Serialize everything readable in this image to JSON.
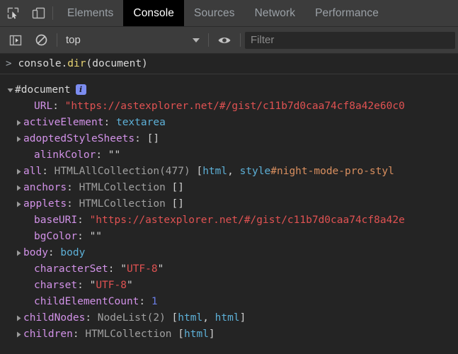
{
  "tabbar": {
    "icons": [
      {
        "name": "inspect-element-icon",
        "title": "Inspect element"
      },
      {
        "name": "device-toolbar-icon",
        "title": "Toggle device toolbar"
      }
    ],
    "tabs": [
      {
        "label": "Elements",
        "active": false
      },
      {
        "label": "Console",
        "active": true
      },
      {
        "label": "Sources",
        "active": false
      },
      {
        "label": "Network",
        "active": false
      },
      {
        "label": "Performance",
        "active": false
      }
    ]
  },
  "console_toolbar": {
    "sidebar_toggle_label": "console-sidebar-icon",
    "clear_label": "clear-console-icon",
    "context": "top",
    "eye_label": "live-expression-icon",
    "filter_value": "",
    "filter_placeholder": "Filter"
  },
  "prompt": {
    "arrow": ">",
    "cmd_a": "console.",
    "cmd_b": "dir",
    "cmd_c": "(document)"
  },
  "output": {
    "root": {
      "name": "#document",
      "info_badge": "i",
      "expanded": true
    },
    "properties": [
      {
        "key": "URL",
        "expandable": false,
        "value_parts": [
          {
            "text": ": ",
            "cls": "punct"
          },
          {
            "text": "\"https://astexplorer.net/#/gist/c11b7d0caa74cf8a42e60c0",
            "cls": "v-string"
          }
        ]
      },
      {
        "key": "activeElement",
        "expandable": true,
        "value_parts": [
          {
            "text": ": ",
            "cls": "punct"
          },
          {
            "text": "textarea",
            "cls": "v-node"
          }
        ]
      },
      {
        "key": "adoptedStyleSheets",
        "expandable": true,
        "value_parts": [
          {
            "text": ": ",
            "cls": "punct"
          },
          {
            "text": "[]",
            "cls": "punct"
          }
        ]
      },
      {
        "key": "alinkColor",
        "expandable": false,
        "value_parts": [
          {
            "text": ": ",
            "cls": "punct"
          },
          {
            "text": "\"\"",
            "cls": "punct"
          }
        ]
      },
      {
        "key": "all",
        "expandable": true,
        "value_parts": [
          {
            "text": ": ",
            "cls": "punct"
          },
          {
            "text": "HTMLAllCollection(477) ",
            "cls": "v-gray"
          },
          {
            "text": "[",
            "cls": "punct"
          },
          {
            "text": "html",
            "cls": "v-node"
          },
          {
            "text": ", ",
            "cls": "punct"
          },
          {
            "text": "style",
            "cls": "v-node"
          },
          {
            "text": "#night-mode-pro-styl",
            "cls": "v-orange"
          }
        ]
      },
      {
        "key": "anchors",
        "expandable": true,
        "value_parts": [
          {
            "text": ": ",
            "cls": "punct"
          },
          {
            "text": "HTMLCollection ",
            "cls": "v-gray"
          },
          {
            "text": "[]",
            "cls": "punct"
          }
        ]
      },
      {
        "key": "applets",
        "expandable": true,
        "value_parts": [
          {
            "text": ": ",
            "cls": "punct"
          },
          {
            "text": "HTMLCollection ",
            "cls": "v-gray"
          },
          {
            "text": "[]",
            "cls": "punct"
          }
        ]
      },
      {
        "key": "baseURI",
        "expandable": false,
        "value_parts": [
          {
            "text": ": ",
            "cls": "punct"
          },
          {
            "text": "\"https://astexplorer.net/#/gist/c11b7d0caa74cf8a42e",
            "cls": "v-string"
          }
        ]
      },
      {
        "key": "bgColor",
        "expandable": false,
        "value_parts": [
          {
            "text": ": ",
            "cls": "punct"
          },
          {
            "text": "\"\"",
            "cls": "punct"
          }
        ]
      },
      {
        "key": "body",
        "expandable": true,
        "value_parts": [
          {
            "text": ": ",
            "cls": "punct"
          },
          {
            "text": "body",
            "cls": "v-node"
          }
        ]
      },
      {
        "key": "characterSet",
        "expandable": false,
        "value_parts": [
          {
            "text": ": ",
            "cls": "punct"
          },
          {
            "text": "\"",
            "cls": "punct"
          },
          {
            "text": "UTF-8",
            "cls": "v-string"
          },
          {
            "text": "\"",
            "cls": "punct"
          }
        ]
      },
      {
        "key": "charset",
        "expandable": false,
        "value_parts": [
          {
            "text": ": ",
            "cls": "punct"
          },
          {
            "text": "\"",
            "cls": "punct"
          },
          {
            "text": "UTF-8",
            "cls": "v-string"
          },
          {
            "text": "\"",
            "cls": "punct"
          }
        ]
      },
      {
        "key": "childElementCount",
        "expandable": false,
        "value_parts": [
          {
            "text": ": ",
            "cls": "punct"
          },
          {
            "text": "1",
            "cls": "v-num"
          }
        ]
      },
      {
        "key": "childNodes",
        "expandable": true,
        "value_parts": [
          {
            "text": ": ",
            "cls": "punct"
          },
          {
            "text": "NodeList(2) ",
            "cls": "v-gray"
          },
          {
            "text": "[",
            "cls": "punct"
          },
          {
            "text": "html",
            "cls": "v-node"
          },
          {
            "text": ", ",
            "cls": "punct"
          },
          {
            "text": "html",
            "cls": "v-node"
          },
          {
            "text": "]",
            "cls": "punct"
          }
        ]
      },
      {
        "key": "children",
        "expandable": true,
        "value_parts": [
          {
            "text": ": ",
            "cls": "punct"
          },
          {
            "text": "HTMLCollection ",
            "cls": "v-gray"
          },
          {
            "text": "[",
            "cls": "punct"
          },
          {
            "text": "html",
            "cls": "v-node"
          },
          {
            "text": "]",
            "cls": "punct"
          }
        ]
      }
    ]
  },
  "colors": {
    "background": "#242424",
    "toolbar": "#3c3c3c",
    "active_tab": "#000000",
    "key": "#d292e8",
    "string": "#e05252",
    "node": "#5db0d7",
    "number": "#6c7fe8",
    "gray": "#a0a0a0",
    "badge": "#7c8df0"
  }
}
